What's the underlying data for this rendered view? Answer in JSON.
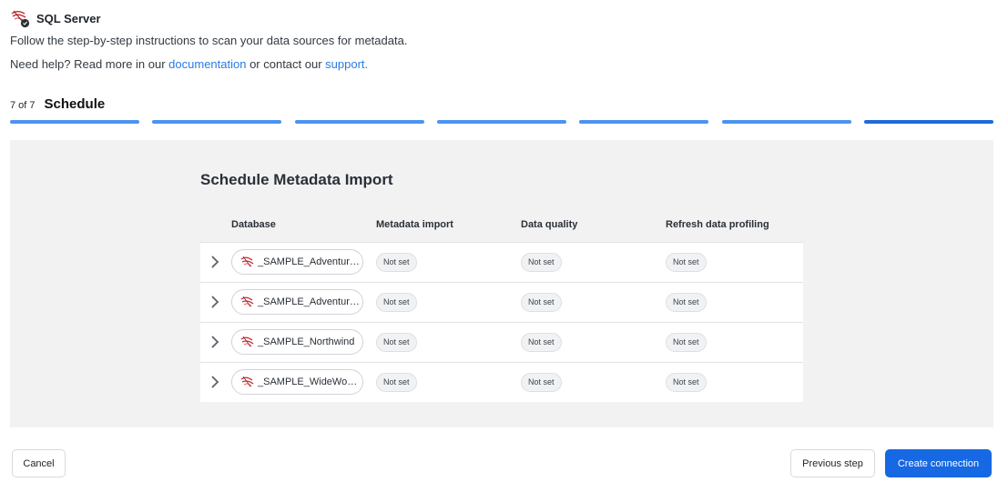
{
  "header": {
    "title": "SQL Server",
    "logo_icon": "sql-server-icon"
  },
  "intro": "Follow the step-by-step instructions to scan your data sources for metadata.",
  "help": {
    "prefix": "Need help? Read more in our ",
    "doc_link": "documentation",
    "middle": " or contact our ",
    "support_link": "support."
  },
  "step": {
    "count": "7 of 7",
    "name": "Schedule",
    "total": 7,
    "current": 7
  },
  "colors": {
    "accent": "#1668e3",
    "progress_done": "#4c93ee",
    "progress_active": "#1f6ad6",
    "link": "#2b7be4"
  },
  "panel": {
    "title": "Schedule Metadata Import"
  },
  "table": {
    "columns": [
      "Database",
      "Metadata import",
      "Data quality",
      "Refresh data profiling"
    ],
    "rows": [
      {
        "database": "_SAMPLE_AdventureWorks",
        "metadata_import": "Not set",
        "data_quality": "Not set",
        "refresh": "Not set"
      },
      {
        "database": "_SAMPLE_AdventureWorksDW",
        "metadata_import": "Not set",
        "data_quality": "Not set",
        "refresh": "Not set"
      },
      {
        "database": "_SAMPLE_Northwind",
        "metadata_import": "Not set",
        "data_quality": "Not set",
        "refresh": "Not set"
      },
      {
        "database": "_SAMPLE_WideWorldImporters",
        "metadata_import": "Not set",
        "data_quality": "Not set",
        "refresh": "Not set"
      }
    ]
  },
  "footer": {
    "cancel": "Cancel",
    "previous": "Previous step",
    "create": "Create connection"
  }
}
